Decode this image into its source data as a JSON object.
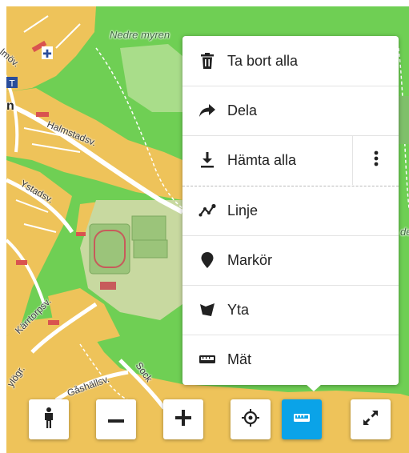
{
  "map": {
    "labels": {
      "nedre_myren": "Nedre myren",
      "imov": "lmöv.",
      "n": "n",
      "halmstadsv": "Halmstadsv.",
      "ystadsv": "Ystadsv.",
      "karrtorpsv": "Kärrtorpsv.",
      "gashallsv": "Gåshällsv.",
      "sock": "Sock",
      "yogr": "ylögr.",
      "de": "de"
    }
  },
  "menu": {
    "items": [
      {
        "label": "Ta bort alla",
        "icon": "trash-icon"
      },
      {
        "label": "Dela",
        "icon": "share-arrow-icon"
      },
      {
        "label": "Hämta alla",
        "icon": "download-icon"
      },
      {
        "label": "Linje",
        "icon": "line-icon"
      },
      {
        "label": "Markör",
        "icon": "marker-icon"
      },
      {
        "label": "Yta",
        "icon": "area-icon"
      },
      {
        "label": "Mät",
        "icon": "ruler-icon"
      }
    ],
    "more_icon": "vertical-dots-icon"
  },
  "controls": [
    {
      "name": "street-view-button",
      "icon": "person-icon"
    },
    {
      "name": "zoom-out-button",
      "icon": "minus-icon"
    },
    {
      "name": "zoom-in-button",
      "icon": "plus-icon"
    },
    {
      "name": "locate-button",
      "icon": "crosshair-icon"
    },
    {
      "name": "measure-button",
      "icon": "ruler-icon",
      "active": true
    },
    {
      "name": "fullscreen-button",
      "icon": "expand-icon"
    }
  ],
  "colors": {
    "accent": "#0aa3e8",
    "map_green": "#6fcf54",
    "map_residential": "#eec35a",
    "map_park": "#9bc47a"
  }
}
